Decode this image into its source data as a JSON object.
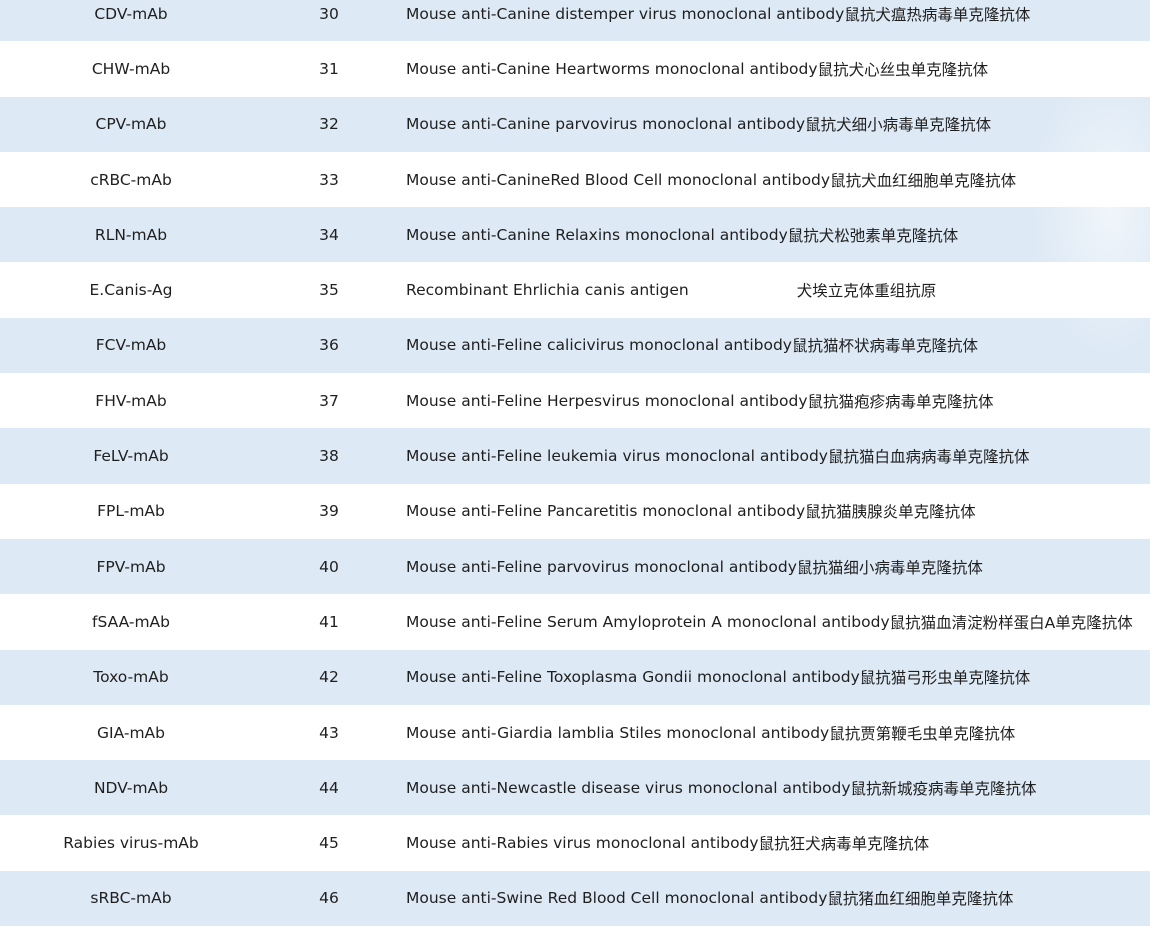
{
  "rows": [
    {
      "code": "CDV-mAb",
      "num": "30",
      "desc_en": "Mouse anti-Canine distemper virus monoclonal antibody",
      "desc_zh": "鼠抗犬瘟热病毒单克隆抗体"
    },
    {
      "code": "CHW-mAb",
      "num": "31",
      "desc_en": "Mouse anti-Canine Heartworms monoclonal antibody",
      "desc_zh": "鼠抗犬心丝虫单克隆抗体"
    },
    {
      "code": "CPV-mAb",
      "num": "32",
      "desc_en": "Mouse anti-Canine parvovirus monoclonal antibody",
      "desc_zh": "鼠抗犬细小病毒单克隆抗体"
    },
    {
      "code": "cRBC-mAb",
      "num": "33",
      "desc_en": "Mouse anti-CanineRed Blood Cell monoclonal antibody ",
      "desc_zh": "鼠抗犬血红细胞单克隆抗体"
    },
    {
      "code": "RLN-mAb",
      "num": "34",
      "desc_en": "Mouse anti-Canine Relaxins monoclonal antibody",
      "desc_zh": "鼠抗犬松弛素单克隆抗体"
    },
    {
      "code": "E.Canis-Ag",
      "num": "35",
      "desc_en": "Recombinant  Ehrlichia canis antigen",
      "desc_zh": "犬埃立克体重组抗原",
      "gap": true
    },
    {
      "code": "FCV-mAb",
      "num": "36",
      "desc_en": "Mouse anti-Feline calicivirus monoclonal antibody",
      "desc_zh": "鼠抗猫杯状病毒单克隆抗体"
    },
    {
      "code": "FHV-mAb",
      "num": "37",
      "desc_en": "Mouse anti-Feline Herpesvirus monoclonal antibody",
      "desc_zh": "鼠抗猫疱疹病毒单克隆抗体"
    },
    {
      "code": "FeLV-mAb",
      "num": "38",
      "desc_en": "Mouse anti-Feline leukemia virus monoclonal antibody",
      "desc_zh": "鼠抗猫白血病病毒单克隆抗体"
    },
    {
      "code": "FPL-mAb",
      "num": "39",
      "desc_en": "Mouse anti-Feline Pancaretitis monoclonal antibody",
      "desc_zh": "鼠抗猫胰腺炎单克隆抗体"
    },
    {
      "code": "FPV-mAb",
      "num": "40",
      "desc_en": "Mouse anti-Feline parvovirus monoclonal antibody",
      "desc_zh": "鼠抗猫细小病毒单克隆抗体"
    },
    {
      "code": "fSAA-mAb",
      "num": "41",
      "desc_en": "Mouse anti-Feline Serum Amyloprotein A monoclonal antibody ",
      "desc_zh": "鼠抗猫血清淀粉样蛋白A单克隆抗体"
    },
    {
      "code": "Toxo-mAb",
      "num": "42",
      "desc_en": "Mouse anti-Feline Toxoplasma Gondii monoclonal antibody",
      "desc_zh": "鼠抗猫弓形虫单克隆抗体"
    },
    {
      "code": "GIA-mAb",
      "num": "43",
      "desc_en": "Mouse anti-Giardia lamblia Stiles monoclonal antibody",
      "desc_zh": "鼠抗贾第鞭毛虫单克隆抗体"
    },
    {
      "code": "NDV-mAb",
      "num": "44",
      "desc_en": "Mouse anti-Newcastle disease virus monoclonal antibody",
      "desc_zh": "鼠抗新城疫病毒单克隆抗体"
    },
    {
      "code": "Rabies virus-mAb",
      "num": "45",
      "desc_en": "Mouse anti-Rabies virus monoclonal antibody",
      "desc_zh": "鼠抗狂犬病毒单克隆抗体"
    },
    {
      "code": "sRBC-mAb",
      "num": "46",
      "desc_en": "Mouse anti-Swine Red Blood Cell monoclonal antibody ",
      "desc_zh": "鼠抗猪血红细胞单克隆抗体"
    }
  ],
  "colors": {
    "stripe": "#dde9f5",
    "plain": "#ffffff",
    "text": "#1f1f1f"
  }
}
